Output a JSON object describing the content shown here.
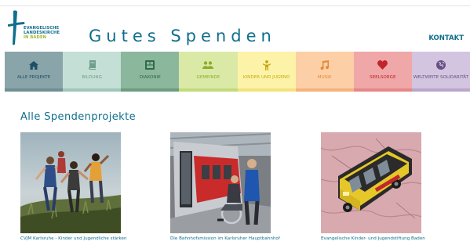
{
  "header": {
    "logo_lines": [
      "EVANGELISCHE",
      "LANDESKIRCHE",
      "IN BADEN"
    ],
    "site_title": "Gutes Spenden",
    "contact_link": "KONTAKT"
  },
  "nav": {
    "items": [
      {
        "label": "ALLE PROJEKTE",
        "icon": "home-icon",
        "bg": "#89a5a9",
        "bar": "#6e8f93",
        "color": "#1e4f66"
      },
      {
        "label": "BILDUNG",
        "icon": "book-icon",
        "bg": "#c4dfd5",
        "bar": "#9fc6b8",
        "color": "#6f9e8c"
      },
      {
        "label": "DIAKONIE",
        "icon": "diakonie-icon",
        "bg": "#8bb79c",
        "bar": "#6b9c7f",
        "color": "#2f6a4a"
      },
      {
        "label": "GEMEINDE",
        "icon": "people-icon",
        "bg": "#daeaa6",
        "bar": "#c2da7a",
        "color": "#8aad2e"
      },
      {
        "label": "KINDER UND JUGEND",
        "icon": "child-icon",
        "bg": "#fdf3a8",
        "bar": "#f3e27b",
        "color": "#c7a818"
      },
      {
        "label": "MUSIK",
        "icon": "music-icon",
        "bg": "#fdcfa6",
        "bar": "#f5b27a",
        "color": "#e08a3a"
      },
      {
        "label": "SEELSORGE",
        "icon": "heart-icon",
        "bg": "#f0a7a8",
        "bar": "#e58687",
        "color": "#c0242c"
      },
      {
        "label": "WELTWEITE SOLIDARITÄT",
        "icon": "globe-icon",
        "bg": "#d3c5df",
        "bar": "#b9a6cb",
        "color": "#6a4f86"
      }
    ]
  },
  "main": {
    "section_title": "Alle Spendenprojekte",
    "projects": [
      {
        "caption": "CVJM Karlsruhe - Kinder und Jugendliche stärken"
      },
      {
        "caption": "Die Bahnhofsmission im Karlsruher Hauptbahnhof"
      },
      {
        "caption": "Evangelische Kinder- und Jugendstiftung Baden"
      }
    ]
  }
}
